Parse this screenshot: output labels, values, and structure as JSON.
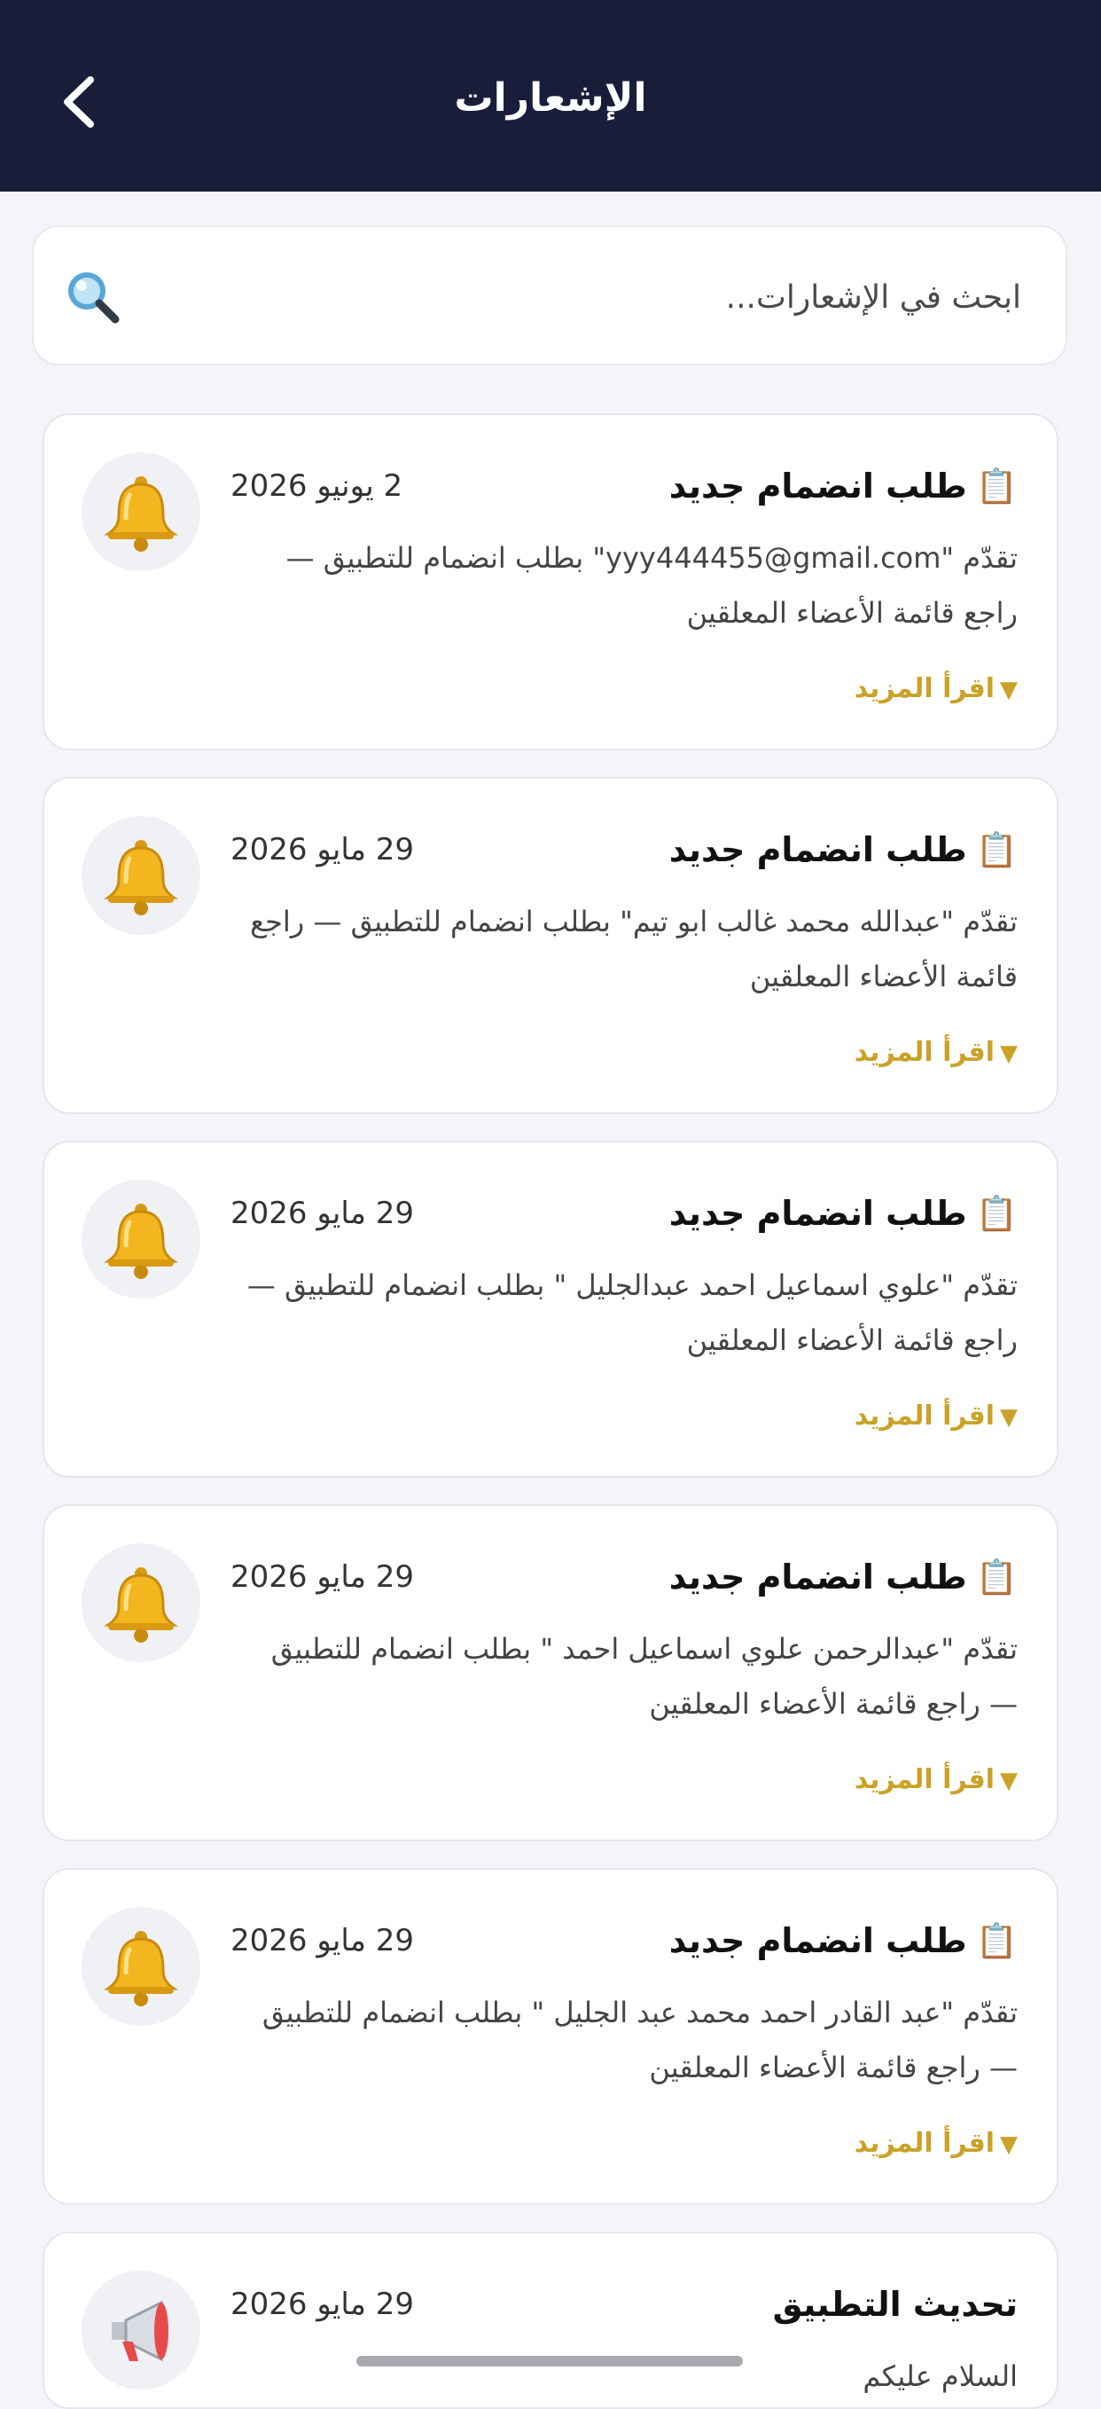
{
  "header": {
    "title": "الإشعارات"
  },
  "search": {
    "placeholder": "ابحث في الإشعارات..."
  },
  "colors": {
    "header_bg": "#181d3a",
    "accent_gold": "#c9a227",
    "page_bg": "#f4f5f9"
  },
  "notifications": [
    {
      "icon": "bell-icon",
      "title_icon": "📋",
      "title": "طلب انضمام جديد",
      "date": "2 يونيو 2026",
      "body": "تقدّم \"yyy444455@gmail.com\" بطلب انضمام للتطبيق — راجع قائمة الأعضاء المعلقين",
      "read_more": "اقرأ المزيد"
    },
    {
      "icon": "bell-icon",
      "title_icon": "📋",
      "title": "طلب انضمام جديد",
      "date": "29 مايو 2026",
      "body": "تقدّم \"عبدالله محمد غالب ابو تيم\" بطلب انضمام للتطبيق — راجع قائمة الأعضاء المعلقين",
      "read_more": "اقرأ المزيد"
    },
    {
      "icon": "bell-icon",
      "title_icon": "📋",
      "title": "طلب انضمام جديد",
      "date": "29 مايو 2026",
      "body": "تقدّم \"علوي اسماعيل احمد عبدالجليل \" بطلب انضمام للتطبيق — راجع قائمة الأعضاء المعلقين",
      "read_more": "اقرأ المزيد"
    },
    {
      "icon": "bell-icon",
      "title_icon": "📋",
      "title": "طلب انضمام جديد",
      "date": "29 مايو 2026",
      "body": "تقدّم \"عبدالرحمن علوي اسماعيل احمد \" بطلب انضمام للتطبيق — راجع قائمة الأعضاء المعلقين",
      "read_more": "اقرأ المزيد"
    },
    {
      "icon": "bell-icon",
      "title_icon": "📋",
      "title": "طلب انضمام جديد",
      "date": "29 مايو 2026",
      "body": "تقدّم \"عبد القادر احمد محمد عبد الجليل \" بطلب انضمام للتطبيق — راجع قائمة الأعضاء المعلقين",
      "read_more": "اقرأ المزيد"
    },
    {
      "icon": "megaphone-icon",
      "title": "تحديث التطبيق",
      "date": "29 مايو 2026",
      "body": "السلام عليكم"
    }
  ]
}
